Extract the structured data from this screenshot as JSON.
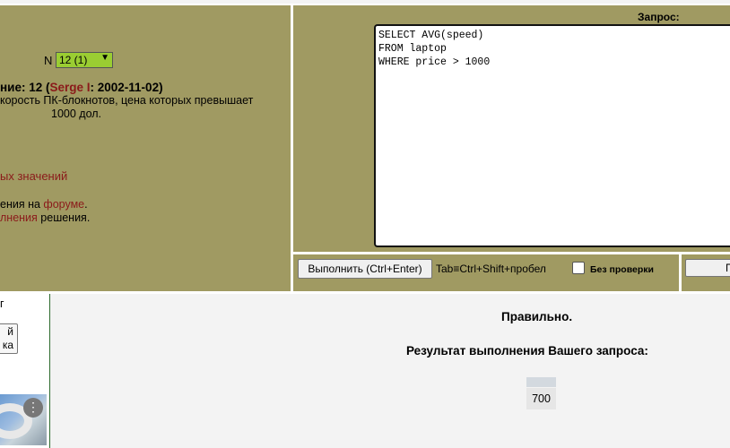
{
  "task": {
    "n_label": "N",
    "n_selected": "12 (1)",
    "title_prefix": "ние: 12 (",
    "author": "Serge I",
    "title_suffix": ": 2002-11-02)",
    "text_line1": "корость ПК-блокнотов, цена которых превышает",
    "text_line2": "1000 дол.",
    "link_values": "ых значений",
    "forum_prefix": "ения на ",
    "forum_link": "форуме",
    "forum_suffix": ".",
    "exec_link": "лнения",
    "exec_suffix": " решения."
  },
  "query": {
    "label": "Запрос:",
    "text": "SELECT AVG(speed)\nFROM laptop\nWHERE price > 1000"
  },
  "toolbar": {
    "run_label": "Выполнить (Ctrl+Enter)",
    "tab_hint": "Tab≡Ctrl+Shift+пробел",
    "nocheck_label": "Без проверки",
    "right_button_label": "П"
  },
  "side": {
    "text1": "г",
    "button_text": "й\nка",
    "image_icon": "more-vert-icon"
  },
  "result": {
    "status": "Правильно.",
    "title": "Результат выполнения Вашего запроса:",
    "columns": [
      ""
    ],
    "rows": [
      [
        "700"
      ]
    ]
  },
  "colors": {
    "panel_bg": "#a09a62",
    "link": "#8b1a1a",
    "select_bg": "#9acd32"
  }
}
